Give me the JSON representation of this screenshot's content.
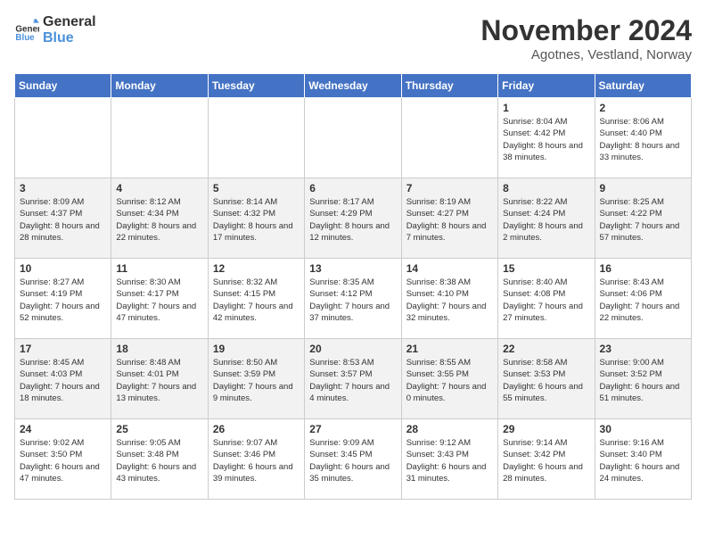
{
  "logo": {
    "line1": "General",
    "line2": "Blue"
  },
  "title": "November 2024",
  "subtitle": "Agotnes, Vestland, Norway",
  "days_of_week": [
    "Sunday",
    "Monday",
    "Tuesday",
    "Wednesday",
    "Thursday",
    "Friday",
    "Saturday"
  ],
  "weeks": [
    [
      {
        "num": "",
        "info": ""
      },
      {
        "num": "",
        "info": ""
      },
      {
        "num": "",
        "info": ""
      },
      {
        "num": "",
        "info": ""
      },
      {
        "num": "",
        "info": ""
      },
      {
        "num": "1",
        "info": "Sunrise: 8:04 AM\nSunset: 4:42 PM\nDaylight: 8 hours and 38 minutes."
      },
      {
        "num": "2",
        "info": "Sunrise: 8:06 AM\nSunset: 4:40 PM\nDaylight: 8 hours and 33 minutes."
      }
    ],
    [
      {
        "num": "3",
        "info": "Sunrise: 8:09 AM\nSunset: 4:37 PM\nDaylight: 8 hours and 28 minutes."
      },
      {
        "num": "4",
        "info": "Sunrise: 8:12 AM\nSunset: 4:34 PM\nDaylight: 8 hours and 22 minutes."
      },
      {
        "num": "5",
        "info": "Sunrise: 8:14 AM\nSunset: 4:32 PM\nDaylight: 8 hours and 17 minutes."
      },
      {
        "num": "6",
        "info": "Sunrise: 8:17 AM\nSunset: 4:29 PM\nDaylight: 8 hours and 12 minutes."
      },
      {
        "num": "7",
        "info": "Sunrise: 8:19 AM\nSunset: 4:27 PM\nDaylight: 8 hours and 7 minutes."
      },
      {
        "num": "8",
        "info": "Sunrise: 8:22 AM\nSunset: 4:24 PM\nDaylight: 8 hours and 2 minutes."
      },
      {
        "num": "9",
        "info": "Sunrise: 8:25 AM\nSunset: 4:22 PM\nDaylight: 7 hours and 57 minutes."
      }
    ],
    [
      {
        "num": "10",
        "info": "Sunrise: 8:27 AM\nSunset: 4:19 PM\nDaylight: 7 hours and 52 minutes."
      },
      {
        "num": "11",
        "info": "Sunrise: 8:30 AM\nSunset: 4:17 PM\nDaylight: 7 hours and 47 minutes."
      },
      {
        "num": "12",
        "info": "Sunrise: 8:32 AM\nSunset: 4:15 PM\nDaylight: 7 hours and 42 minutes."
      },
      {
        "num": "13",
        "info": "Sunrise: 8:35 AM\nSunset: 4:12 PM\nDaylight: 7 hours and 37 minutes."
      },
      {
        "num": "14",
        "info": "Sunrise: 8:38 AM\nSunset: 4:10 PM\nDaylight: 7 hours and 32 minutes."
      },
      {
        "num": "15",
        "info": "Sunrise: 8:40 AM\nSunset: 4:08 PM\nDaylight: 7 hours and 27 minutes."
      },
      {
        "num": "16",
        "info": "Sunrise: 8:43 AM\nSunset: 4:06 PM\nDaylight: 7 hours and 22 minutes."
      }
    ],
    [
      {
        "num": "17",
        "info": "Sunrise: 8:45 AM\nSunset: 4:03 PM\nDaylight: 7 hours and 18 minutes."
      },
      {
        "num": "18",
        "info": "Sunrise: 8:48 AM\nSunset: 4:01 PM\nDaylight: 7 hours and 13 minutes."
      },
      {
        "num": "19",
        "info": "Sunrise: 8:50 AM\nSunset: 3:59 PM\nDaylight: 7 hours and 9 minutes."
      },
      {
        "num": "20",
        "info": "Sunrise: 8:53 AM\nSunset: 3:57 PM\nDaylight: 7 hours and 4 minutes."
      },
      {
        "num": "21",
        "info": "Sunrise: 8:55 AM\nSunset: 3:55 PM\nDaylight: 7 hours and 0 minutes."
      },
      {
        "num": "22",
        "info": "Sunrise: 8:58 AM\nSunset: 3:53 PM\nDaylight: 6 hours and 55 minutes."
      },
      {
        "num": "23",
        "info": "Sunrise: 9:00 AM\nSunset: 3:52 PM\nDaylight: 6 hours and 51 minutes."
      }
    ],
    [
      {
        "num": "24",
        "info": "Sunrise: 9:02 AM\nSunset: 3:50 PM\nDaylight: 6 hours and 47 minutes."
      },
      {
        "num": "25",
        "info": "Sunrise: 9:05 AM\nSunset: 3:48 PM\nDaylight: 6 hours and 43 minutes."
      },
      {
        "num": "26",
        "info": "Sunrise: 9:07 AM\nSunset: 3:46 PM\nDaylight: 6 hours and 39 minutes."
      },
      {
        "num": "27",
        "info": "Sunrise: 9:09 AM\nSunset: 3:45 PM\nDaylight: 6 hours and 35 minutes."
      },
      {
        "num": "28",
        "info": "Sunrise: 9:12 AM\nSunset: 3:43 PM\nDaylight: 6 hours and 31 minutes."
      },
      {
        "num": "29",
        "info": "Sunrise: 9:14 AM\nSunset: 3:42 PM\nDaylight: 6 hours and 28 minutes."
      },
      {
        "num": "30",
        "info": "Sunrise: 9:16 AM\nSunset: 3:40 PM\nDaylight: 6 hours and 24 minutes."
      }
    ]
  ]
}
